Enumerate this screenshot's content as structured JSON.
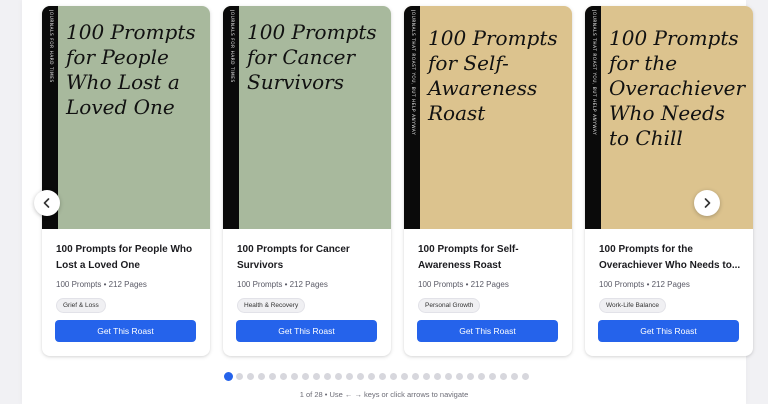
{
  "carousel": {
    "prev_icon": "chevron-left-icon",
    "next_icon": "chevron-right-icon",
    "dot_count": 28,
    "active_index": 0,
    "hint": "1 of 28 • Use ← → keys or click arrows to navigate",
    "accent_color": "#2563eb"
  },
  "cards": [
    {
      "spine_text": "Journals for hard times",
      "cover_title": "100 Prompts for People Who Lost a Loved One",
      "cover_color": "#a8b99d",
      "title_line1": "100 Prompts for People Who",
      "title_line2": "Lost a Loved One",
      "meta": "100 Prompts • 212 Pages",
      "tag": "Grief & Loss",
      "button": "Get This Roast"
    },
    {
      "spine_text": "Journals for hard times",
      "cover_title": "100 Prompts for Cancer Survivors",
      "cover_color": "#a8b99d",
      "title_line1": "100 Prompts for Cancer",
      "title_line2": "Survivors",
      "meta": "100 Prompts • 212 Pages",
      "tag": "Health & Recovery",
      "button": "Get This Roast"
    },
    {
      "spine_text": "Journals that roast you, but help anyway",
      "cover_title": "100 Prompts for Self-Awareness Roast",
      "cover_color": "#dcc38e",
      "title_line1": "100 Prompts for Self-",
      "title_line2": "Awareness Roast",
      "meta": "100 Prompts • 212 Pages",
      "tag": "Personal Growth",
      "button": "Get This Roast"
    },
    {
      "spine_text": "Journals that roast you, but help anyway",
      "cover_title": "100 Prompts for the Overachiever Who Needs to Chill",
      "cover_color": "#dcc38e",
      "title_line1": "100 Prompts for the",
      "title_line2": "Overachiever Who Needs to...",
      "meta": "100 Prompts • 212 Pages",
      "tag": "Work-Life Balance",
      "button": "Get This Roast"
    }
  ]
}
